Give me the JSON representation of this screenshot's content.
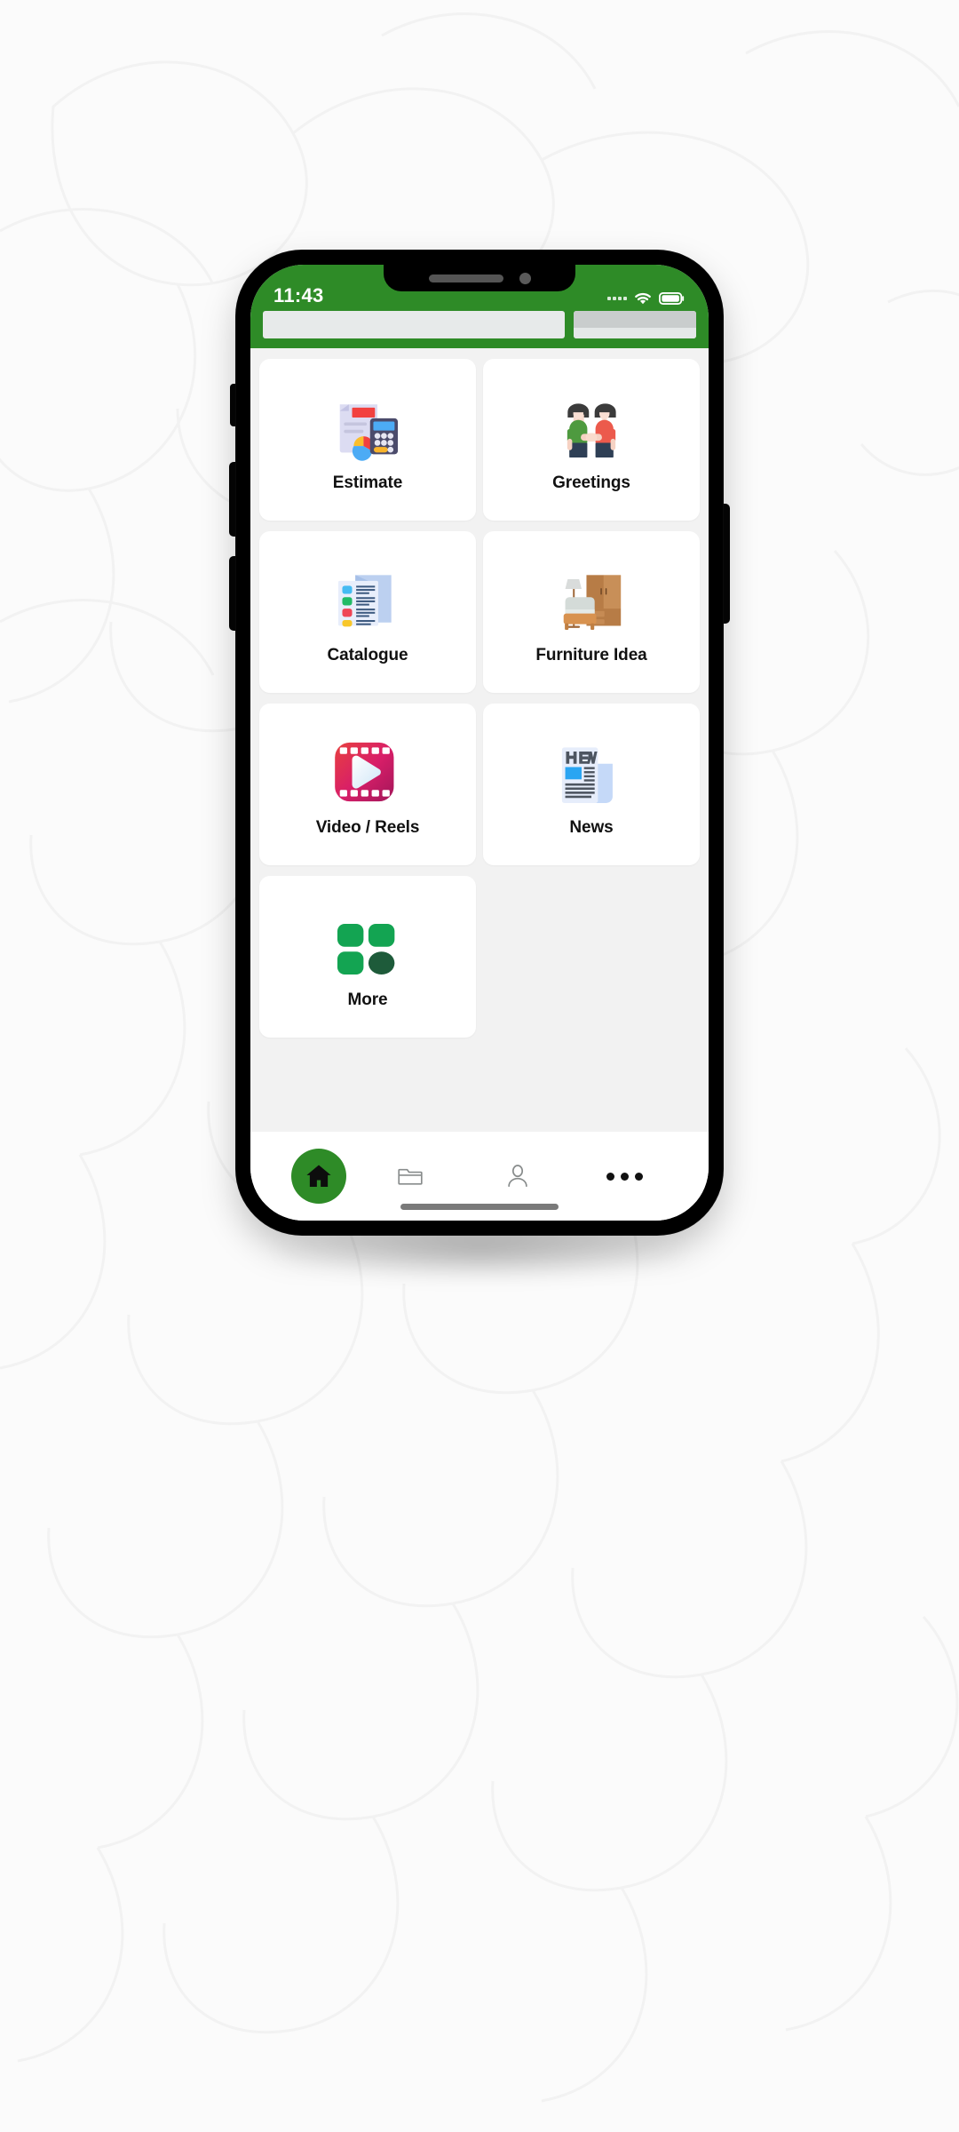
{
  "theme": {
    "brand_green": "#2E8B27",
    "screen_bg": "#F2F2F2",
    "card_bg": "#FFFFFF",
    "label_color": "#111111",
    "more_green": "#15A349",
    "more_dark_green": "#1E5B3A"
  },
  "status_bar": {
    "time": "11:43",
    "signal_icon": "signal-dots-icon",
    "wifi_icon": "wifi-icon",
    "battery_icon": "battery-icon"
  },
  "header": {
    "placeholder_bar_wide": "",
    "placeholder_bar_narrow": ""
  },
  "main": {
    "tiles": [
      {
        "label": "Estimate",
        "icon": "estimate-icon"
      },
      {
        "label": "Greetings",
        "icon": "greetings-icon"
      },
      {
        "label": "Catalogue",
        "icon": "catalogue-icon"
      },
      {
        "label": "Furniture Idea",
        "icon": "furniture-icon"
      },
      {
        "label": "Video / Reels",
        "icon": "video-reels-icon"
      },
      {
        "label": "News",
        "icon": "news-icon"
      },
      {
        "label": "More",
        "icon": "more-grid-icon"
      }
    ]
  },
  "bottom_nav": {
    "items": [
      {
        "name": "home",
        "icon": "home-icon",
        "active": true
      },
      {
        "name": "files",
        "icon": "folder-icon",
        "active": false
      },
      {
        "name": "profile",
        "icon": "person-icon",
        "active": false
      },
      {
        "name": "more",
        "icon": "ellipsis-icon",
        "active": false
      }
    ]
  }
}
